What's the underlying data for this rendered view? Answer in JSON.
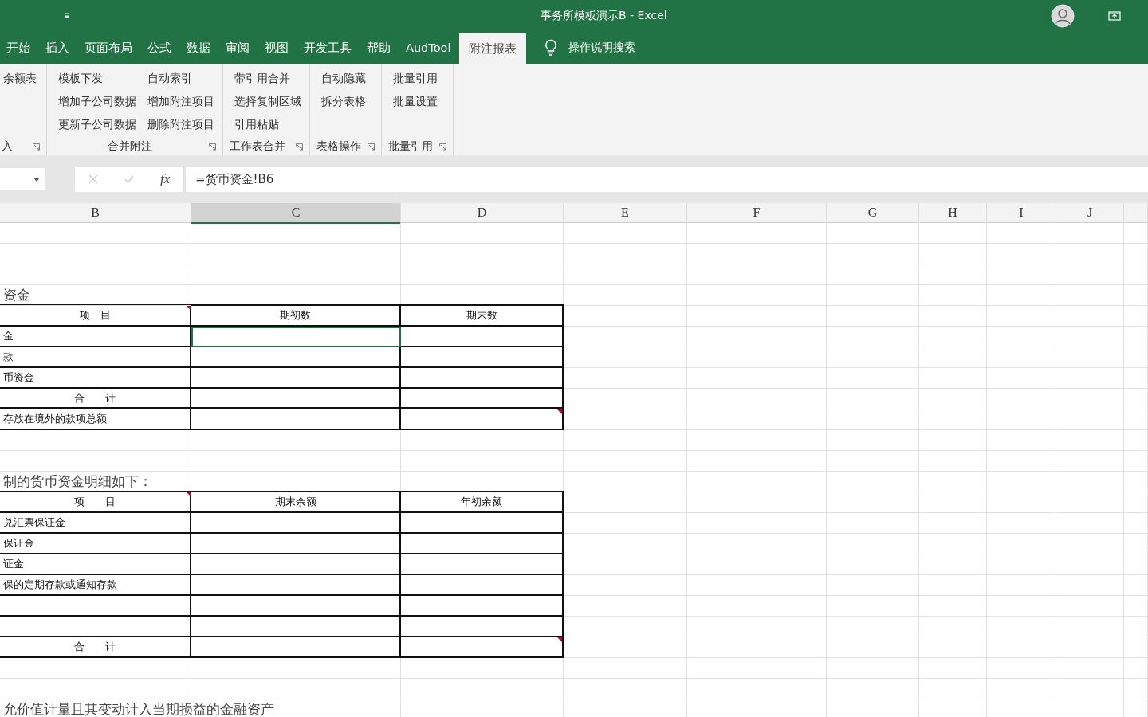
{
  "window": {
    "title": "事务所模板演示B  -  Excel"
  },
  "tabs": [
    {
      "label": "开始",
      "selected": false
    },
    {
      "label": "插入",
      "selected": false
    },
    {
      "label": "页面布局",
      "selected": false
    },
    {
      "label": "公式",
      "selected": false
    },
    {
      "label": "数据",
      "selected": false
    },
    {
      "label": "审阅",
      "selected": false
    },
    {
      "label": "视图",
      "selected": false
    },
    {
      "label": "开发工具",
      "selected": false
    },
    {
      "label": "帮助",
      "selected": false
    },
    {
      "label": "AudTool",
      "selected": false
    },
    {
      "label": "附注报表",
      "selected": true
    }
  ],
  "tell_me": "操作说明搜索",
  "ribbon_groups": [
    {
      "label": "入",
      "columns": [
        [
          "余额表"
        ]
      ]
    },
    {
      "label": "合并附注",
      "columns": [
        [
          "模板下发",
          "增加子公司数据",
          "更新子公司数据"
        ],
        [
          "自动索引",
          "增加附注项目",
          "删除附注项目"
        ]
      ]
    },
    {
      "label": "工作表合并",
      "columns": [
        [
          "带引用合并",
          "选择复制区域",
          "引用粘贴"
        ]
      ]
    },
    {
      "label": "表格操作",
      "columns": [
        [
          "自动隐藏",
          "拆分表格"
        ]
      ]
    },
    {
      "label": "批量引用",
      "columns": [
        [
          "批量引用",
          "批量设置"
        ]
      ]
    }
  ],
  "formula_bar": {
    "fx": "fx",
    "formula": "=货币资金!B6"
  },
  "columns": [
    {
      "label": "B",
      "selected": false
    },
    {
      "label": "C",
      "selected": true
    },
    {
      "label": "D",
      "selected": false
    },
    {
      "label": "E",
      "selected": false
    },
    {
      "label": "F",
      "selected": false
    },
    {
      "label": "G",
      "selected": false
    },
    {
      "label": "H",
      "selected": false
    },
    {
      "label": "I",
      "selected": false
    },
    {
      "label": "J",
      "selected": false
    }
  ],
  "rows": [
    {
      "kind": "blank",
      "selected": false
    },
    {
      "kind": "blank",
      "selected": false
    },
    {
      "kind": "blank",
      "selected": false
    },
    {
      "kind": "title",
      "text": "资金",
      "selected": false
    },
    {
      "kind": "header",
      "labels": [
        "项　目",
        "期初数",
        "期末数"
      ],
      "comment_b": true,
      "selected": false
    },
    {
      "kind": "data",
      "text": "金",
      "selected": true
    },
    {
      "kind": "data",
      "text": "款",
      "selected": false
    },
    {
      "kind": "data",
      "text": "币资金",
      "selected": false
    },
    {
      "kind": "total",
      "text": "合　　计",
      "selected": false
    },
    {
      "kind": "data",
      "text": "存放在境外的款项总额",
      "comment_d": true,
      "selected": false
    },
    {
      "kind": "blank",
      "selected": false
    },
    {
      "kind": "blank",
      "selected": false
    },
    {
      "kind": "title",
      "text": "制的货币资金明细如下：",
      "selected": false
    },
    {
      "kind": "header",
      "labels": [
        "项　　目",
        "期末余额",
        "年初余额"
      ],
      "comment_b": true,
      "selected": false
    },
    {
      "kind": "data",
      "text": "兑汇票保证金",
      "selected": false
    },
    {
      "kind": "data",
      "text": "保证金",
      "selected": false
    },
    {
      "kind": "data",
      "text": "证金",
      "selected": false
    },
    {
      "kind": "data",
      "text": "保的定期存款或通知存款",
      "selected": false
    },
    {
      "kind": "data",
      "selected": false
    },
    {
      "kind": "data",
      "selected": false
    },
    {
      "kind": "total",
      "text": "合　　计",
      "comment_d": true,
      "selected": false
    },
    {
      "kind": "blank",
      "selected": false
    },
    {
      "kind": "blank",
      "selected": false
    },
    {
      "kind": "title",
      "text": "允价值计量且其变动计入当期损益的金融资产",
      "selected": false
    }
  ]
}
